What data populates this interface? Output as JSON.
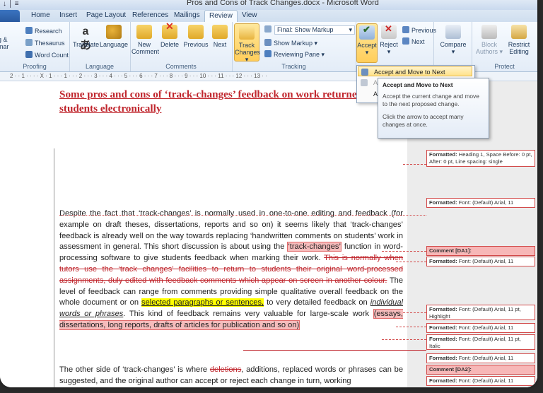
{
  "window": {
    "title": "Pros and Cons of Track Changes.docx - Microsoft Word",
    "qat": "↓ │ ≡"
  },
  "tabs": [
    "Home",
    "Insert",
    "Page Layout",
    "References",
    "Mailings",
    "Review",
    "View"
  ],
  "active_tab": "Review",
  "ribbon": {
    "proofing": {
      "label": "Proofing",
      "research": "Research",
      "thesaurus": "Thesaurus",
      "word_count": "Word Count",
      "spelling_partial": "g &",
      "grammar_partial": "mar"
    },
    "language": {
      "label": "Language",
      "translate": "Translate",
      "language": "Language"
    },
    "comments": {
      "label": "Comments",
      "new_comment_1": "New",
      "new_comment_2": "Comment",
      "delete": "Delete",
      "previous": "Previous",
      "next": "Next"
    },
    "tracking": {
      "label": "Tracking",
      "track_changes_1": "Track",
      "track_changes_2": "Changes",
      "final_show_markup": "Final: Show Markup",
      "show_markup": "Show Markup",
      "reviewing_pane": "Reviewing Pane"
    },
    "changes": {
      "accept": "Accept",
      "reject": "Reject",
      "previous": "Previous",
      "next": "Next"
    },
    "compare": {
      "label": "Compare"
    },
    "protect": {
      "label": "Protect",
      "block_1": "Block",
      "block_2": "Authors",
      "restrict_1": "Restrict",
      "restrict_2": "Editing"
    }
  },
  "ruler": "2 · · 1 · · · · X · 1 · · · 1 · · · 2 · · · 3 · · · 4 · · · 5 · · · 6 · · · 7 · · · 8 · · · 9 · · · 10 · · · 11 · · · 12 · · · 13 · ·",
  "accept_menu": {
    "item1": "Accept and Move to Next",
    "item2": "A",
    "item3": "A",
    "item4": "A"
  },
  "tooltip": {
    "title": "Accept and Move to Next",
    "line1": "Accept the current change and move to the next proposed change.",
    "line2": "Click the arrow to accept many changes at once."
  },
  "document": {
    "heading": "Some pros and cons of ‘track-changes’ feedback on work returned to students electronically",
    "p1_a": "Despite the fact that ‘track-changes’ is normally used in one-to-one editing and feedback (for example on draft theses, dissertations, reports and so on) it seems likely that ‘track-changes’ feedback is already well on the way towards replacing ‘handwritten comments on students’ work in assessment in general. This short discussion is about using the ",
    "p1_comment1": "‘track-changes’",
    "p1_b": " function in word-processing software to give students feedback when marking their work. ",
    "p1_deleted": "This is normally when tutors use the ‘track changes’ facilities to return to students their original word-processed assignments, duly edited with feedback comments which appear on screen in another colour.",
    "p1_c": " The level of feedback can range from comments providing simple qualitative overall feedback on the whole document or on ",
    "p1_highlight": "selected paragraphs or sentences,",
    "p1_d": " to very detailed feedback on ",
    "p1_italic": "individual words or phrases",
    "p1_e": ". This kind of feedback remains very valuable for large-scale work ",
    "p1_comment2": "(essays, dissertations, long reports, drafts of articles for publication and so on)",
    "p2_a": "The other side of ‘track-changes’ is where ",
    "p2_deleted": "deletions",
    "p2_b": ", additions, replaced words or phrases can be suggested, and the original author can accept or reject each change in turn, working"
  },
  "balloons": [
    {
      "label": "Formatted:",
      "text": " Heading 1, Space Before: 0 pt, After: 0 pt, Line spacing: single"
    },
    {
      "label": "Formatted:",
      "text": " Font: (Default) Arial, 11"
    },
    {
      "label": "Comment [DA1]:",
      "text": ""
    },
    {
      "label": "Formatted:",
      "text": " Font: (Default) Arial, 11"
    },
    {
      "label": "Formatted:",
      "text": " Font: (Default) Arial, 11 pt, Highlight"
    },
    {
      "label": "Formatted:",
      "text": " Font: (Default) Arial, 11"
    },
    {
      "label": "Formatted:",
      "text": " Font: (Default) Arial, 11 pt, Italic"
    },
    {
      "label": "Formatted:",
      "text": " Font: (Default) Arial, 11"
    },
    {
      "label": "Comment [DA2]:",
      "text": ""
    },
    {
      "label": "Formatted:",
      "text": " Font: (Default) Arial, 11"
    }
  ],
  "colors": {
    "accent": "#2a5aa0",
    "revision_red": "#c0262d",
    "highlight": "#ffff00",
    "comment_fill": "#f6bcbc"
  }
}
